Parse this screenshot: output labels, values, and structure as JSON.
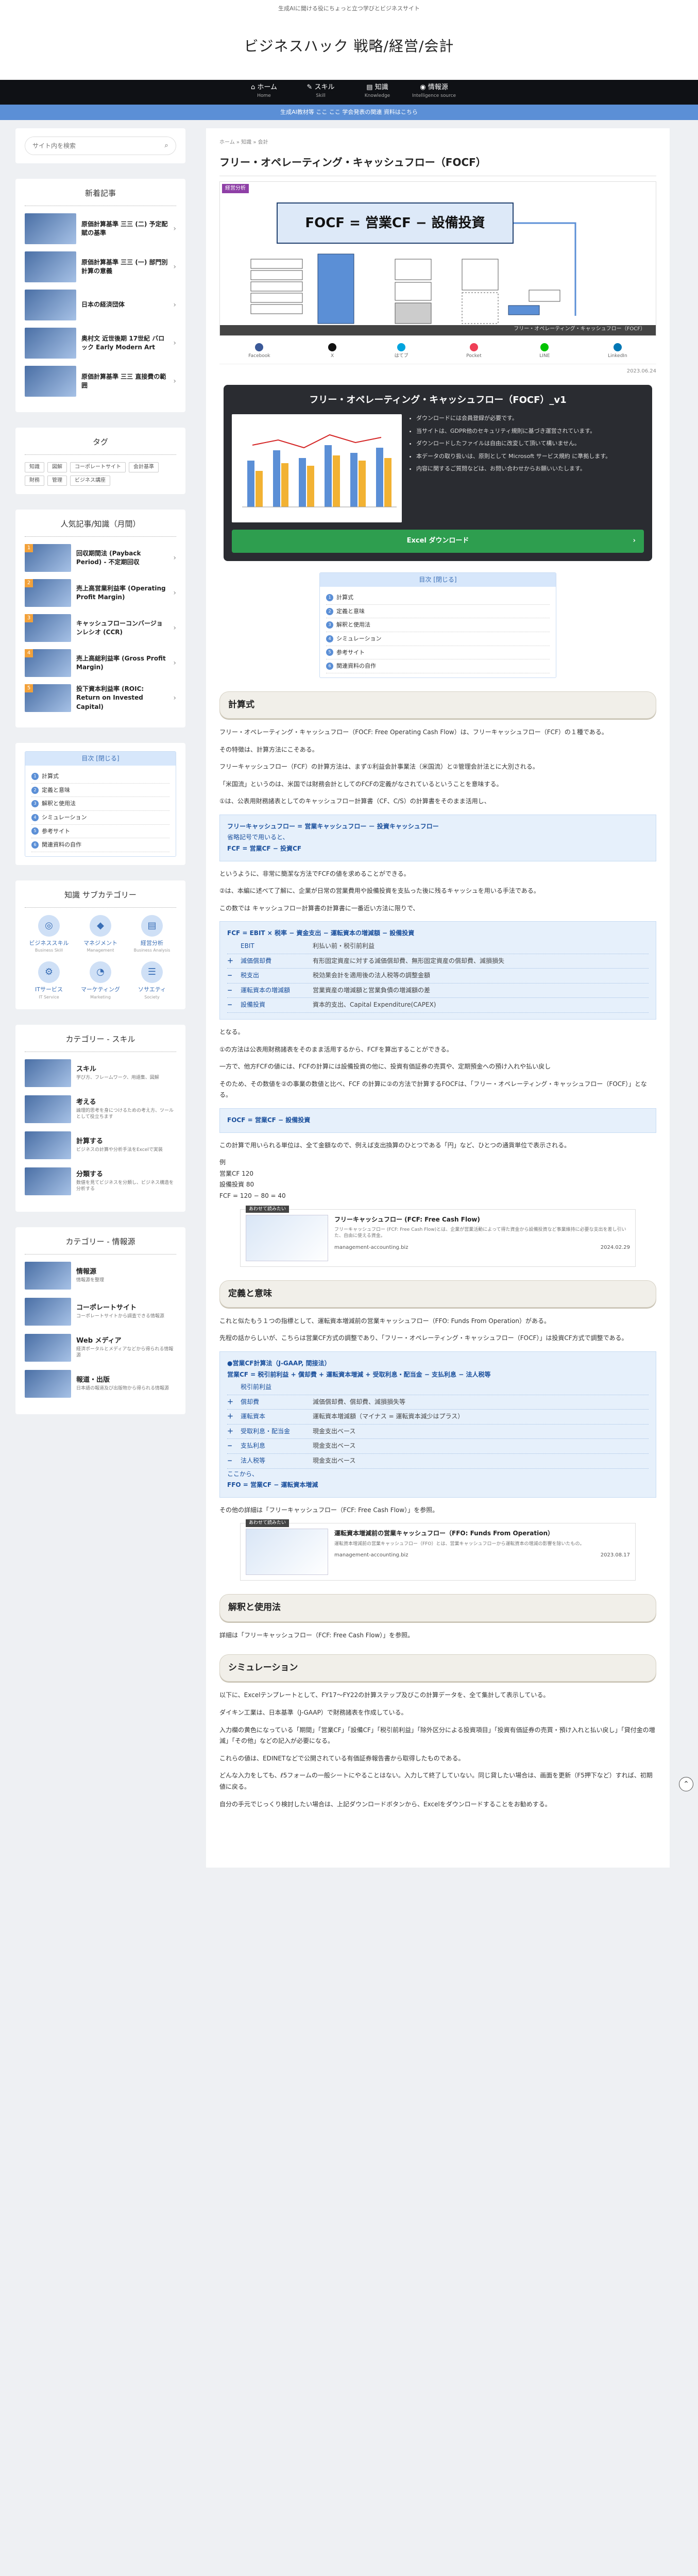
{
  "topbar": {
    "tagline": "生成AIに聞ける役にちょっと立つ学びとビジネスサイト"
  },
  "header": {
    "site_title": "ビジネスハック 戦略/経営/会計"
  },
  "gnav": [
    {
      "label": "ホーム",
      "sub": "Home"
    },
    {
      "label": "スキル",
      "sub": "Skill"
    },
    {
      "label": "知識",
      "sub": "Knowledge"
    },
    {
      "label": "情報源",
      "sub": "Intelligence source"
    }
  ],
  "notice": "生成AI教材等 ここ ここ 学会発表の関連 資料はこちら",
  "search": {
    "placeholder": "サイト内を検索"
  },
  "sidebar": {
    "new_title": "新着記事",
    "new_posts": [
      "原価計算基準 三三 (二) 予定配賦の基準",
      "原価計算基準 三三 (一) 部門別計算の意義",
      "日本の経済団体",
      "奥村文 近世後期 17世紀 バロック Early Modern Art",
      "原価計算基準 三三 直接費の範囲"
    ],
    "tag_title": "タグ",
    "tags": [
      "知識",
      "図解",
      "コーポレートサイト",
      "会計基準",
      "財務",
      "管理",
      "ビジネス講座"
    ],
    "rank_title": "人気記事/知識（月間）",
    "rank_posts": [
      "回収期間法 (Payback Period) - 不定期回収",
      "売上高営業利益率 (Operating Profit Margin)",
      "キャッシュフローコンバージョンレシオ (CCR)",
      "売上高総利益率 (Gross Profit Margin)",
      "投下資本利益率 (ROIC: Return on Invested Capital)"
    ],
    "toc_title": "目次 [閉じる]",
    "toc_items": [
      "計算式",
      "定義と意味",
      "解釈と使用法",
      "シミュレーション",
      "参考サイト",
      "関連資料の自作"
    ],
    "cat_title": "知識 サブカテゴリー",
    "cats": [
      {
        "label": "ビジネススキル",
        "sub": "Business Skill",
        "icon": "◎"
      },
      {
        "label": "マネジメント",
        "sub": "Management",
        "icon": "◆"
      },
      {
        "label": "経営分析",
        "sub": "Business Analysis",
        "icon": "▤"
      },
      {
        "label": "ITサービス",
        "sub": "IT Service",
        "icon": "⚙"
      },
      {
        "label": "マーケティング",
        "sub": "Marketing",
        "icon": "◔"
      },
      {
        "label": "ソサエティ",
        "sub": "Society",
        "icon": "☰"
      }
    ],
    "skill_title": "カテゴリー - スキル",
    "skills": [
      {
        "h": "スキル",
        "d": "学び方、フレームワーク、用語集、図解"
      },
      {
        "h": "考える",
        "d": "論理的思考を身につけるための考え方、ツールとして役立ちます"
      },
      {
        "h": "計算する",
        "d": "ビジネスの計算や分析手法をExcelで実装"
      },
      {
        "h": "分類する",
        "d": "数値を見てビジネスを分類し、ビジネス構造を分析する"
      }
    ],
    "info_title": "カテゴリー - 情報源",
    "infos": [
      {
        "h": "情報源",
        "d": "情報源を整理"
      },
      {
        "h": "コーポレートサイト",
        "d": "コーポレートサイトから調査できる情報源"
      },
      {
        "h": "Web メディア",
        "d": "経済ポータルとメディアなどから得られる情報源"
      },
      {
        "h": "報道・出版",
        "d": "日本語の報道及び出版物から得られる情報源"
      }
    ]
  },
  "breadcrumb": "ホーム  »  知識  »  会計",
  "article": {
    "title": "フリー・オペレーティング・キャッシュフロー（FOCF）",
    "badge": "経営分析",
    "hero_formula": "FOCF = 営業CF − 設備投資",
    "hero_footer": "フリー・オペレーティング・キャッシュフロー（FOCF）",
    "share": [
      "Facebook",
      "X",
      "はてブ",
      "Pocket",
      "LINE",
      "LinkedIn"
    ],
    "date": "2023.06.24",
    "dl": {
      "title": "フリー・オペレーティング・キャッシュフロー（FOCF）_v1",
      "notes": [
        "ダウンロードには会員登録が必要です。",
        "当サイトは、GDPR他のセキュリティ規則に基づき運営されています。",
        "ダウンロードしたファイルは自由に改変して頂いて構いません。",
        "本データの取り扱いは、原則として Microsoft サービス規約 に準拠します。",
        "内容に関するご質問などは、お問い合わせからお願いいたします。"
      ],
      "button": "Excel ダウンロード"
    },
    "toc_title": "目次 [閉じる]",
    "toc": [
      "計算式",
      "定義と意味",
      "解釈と使用法",
      "シミュレーション",
      "参考サイト",
      "関連資料の自作"
    ],
    "sec1": "計算式",
    "p1": "フリー・オペレーティング・キャッシュフロー（FOCF: Free Operating Cash Flow）は、フリーキャッシュフロー（FCF）の１種である。",
    "p2": "その特徴は、計算方法にこそある。",
    "p3": "フリーキャッシュフロー（FCF）の計算方法は、まず①利益会計事業法（米国流）と②管理会計法とに大別される。",
    "p4": "「米国流」というのは、米国では財務会計としてのFCFの定義がなされているということを意味する。",
    "p5": "①は、公表用財務諸表としてのキャッシュフロー計算書（CF、C/S）の計算書をそのまま活用し、",
    "f1_l1": "フリーキャッシュフロー = 営業キャッシュフロー － 投資キャッシュフロー",
    "f1_l2": "省略記号で用いると、",
    "f1_l3": "FCF = 営業CF − 投資CF",
    "p6": "というように、非常に簡潔な方法でFCFの値を求めることができる。",
    "p7": "②は、本編に述べて了解に、企業が日常の営業費用や設備投資を支払った後に残るキャッシュを用いる手法である。",
    "p8": "この数では キャッシュフロー計算書の計算書に一番近い方法に限りで、",
    "f2_head": "FCF = EBIT × 税率 − 資金支出 − 運転資本の増減額 − 設備投資",
    "f2_rows": [
      {
        "op": "",
        "k": "EBIT",
        "v": "利払い前・税引前利益"
      },
      {
        "op": "＋",
        "k": "減価償却費",
        "v": "有形固定資産に対する減価償却費、無形固定資産の償却費、減損損失"
      },
      {
        "op": "−",
        "k": "税支出",
        "v": "税効果会計を適用後の法人税等の調整金額"
      },
      {
        "op": "−",
        "k": "運転資本の増減額",
        "v": "営業資産の増減額と営業負債の増減額の差"
      },
      {
        "op": "−",
        "k": "設備投資",
        "v": "資本的支出、Capital Expenditure(CAPEX)"
      }
    ],
    "p9": "となる。",
    "p10": "①の方法は公表用財務諸表をそのまま活用するから、FCFを算出することができる。",
    "p11": "一方で、他方FCFの値には、FCFの計算には設備投資の他に、投資有価証券の売買や、定期預金への預け入れや払い戻し",
    "p12": "そのため、その数値を②の事業の数値と比べ、FCF の計算に②の方法で計算するFOCFは、「フリー・オペレーティング・キャッシュフロー（FOCF）」となる。",
    "f3": "FOCF = 営業CF − 設備投資",
    "p13": "この計算で用いられる単位は、全て金額なので、例えば支出換算のひとつである「円」など、ひとつの通貨単位で表示される。",
    "ex_head": "例",
    "ex_lines": [
      "営業CF 120",
      "設備投資 80",
      "FCF = 120 − 80 = 40"
    ],
    "card1": {
      "label": "あわせて読みたい",
      "title": "フリーキャッシュフロー (FCF: Free Cash Flow)",
      "desc": "フリーキャッシュフロー (FCF: Free Cash Flow)とは、企業が営業活動によって得た資金から設備投資など事業維持に必要な支出を差し引いた、自由に使える資金。",
      "site": "management-accounting.biz",
      "date": "2024.02.29"
    },
    "sec2": "定義と意味",
    "p14": "これと似たもう１つの指標として、運転資本増減前の営業キャッシュフロー（FFO: Funds From Operation）がある。",
    "p15": "先程の話からしいが、こちらは営業CF方式の調整であり、「フリー・オペレーティング・キャッシュフロー（FOCF）」は投資CF方式で調整である。",
    "f4_head": "●営業CF計算法（J-GAAP, 間接法）",
    "f4_sub": "営業CF = 税引前利益 + 償却費 + 運転資本増減 + 受取利息・配当金 − 支払利息 − 法人税等",
    "f4_rows": [
      {
        "op": "",
        "k": "税引前利益",
        "v": ""
      },
      {
        "op": "＋",
        "k": "償却費",
        "v": "減価償却費、償却費、減損損失等"
      },
      {
        "op": "＋",
        "k": "運転資本",
        "v": "運転資本増減額（マイナス = 運転資本減少はプラス）"
      },
      {
        "op": "＋",
        "k": "受取利息・配当金",
        "v": "現金支出ベース"
      },
      {
        "op": "−",
        "k": "支払利息",
        "v": "現金支出ベース"
      },
      {
        "op": "−",
        "k": "法人税等",
        "v": "現金支出ベース"
      }
    ],
    "f4_tail": "ここから、",
    "f4_res": "FFO = 営業CF − 運転資本増減",
    "p16": "その他の詳細は「フリーキャッシュフロー（FCF: Free Cash Flow）」を参照。",
    "card2": {
      "label": "あわせて読みたい",
      "title": "運転資本増減前の営業キャッシュフロー（FFO: Funds From Operation）",
      "desc": "運転資本増減前の営業キャッシュフロー（FFO）とは、営業キャッシュフローから運転資本の増減の影響を除いたもの。",
      "site": "management-accounting.biz",
      "date": "2023.08.17"
    },
    "sec3": "解釈と使用法",
    "p17": "詳細は「フリーキャッシュフロー（FCF: Free Cash Flow）」を参照。",
    "sec4": "シミュレーション",
    "p18": "以下に、Excelテンプレートとして、FY17〜FY22の計算ステップ及びこの計算データを、全て集計して表示している。",
    "p19": "ダイキン工業は、日本基準（J-GAAP）で財務諸表を作成している。",
    "p20": "入力欄の黄色になっている「期間」「営業CF」「設備CF」「税引前利益」「除外区分による投資項目」「投資有価証券の売買・預け入れと払い戻し」「貸付金の増減」「その他」などの記入が必要になる。",
    "p21": "これらの値は、EDINETなどで公開されている有価証券報告書から取得したものである。",
    "p22": "どんな入力をしても、ℓ5フォームの一般シートにやることはない。入力して終了していない。同じ貸したい場合は、画面を更新（F5押下など）すれば、初期値に戻る。",
    "p23": "自分の手元でじっくり検討したい場合は、上記ダウンロードボタンから、Excelをダウンロードすることをお勧めする。"
  }
}
